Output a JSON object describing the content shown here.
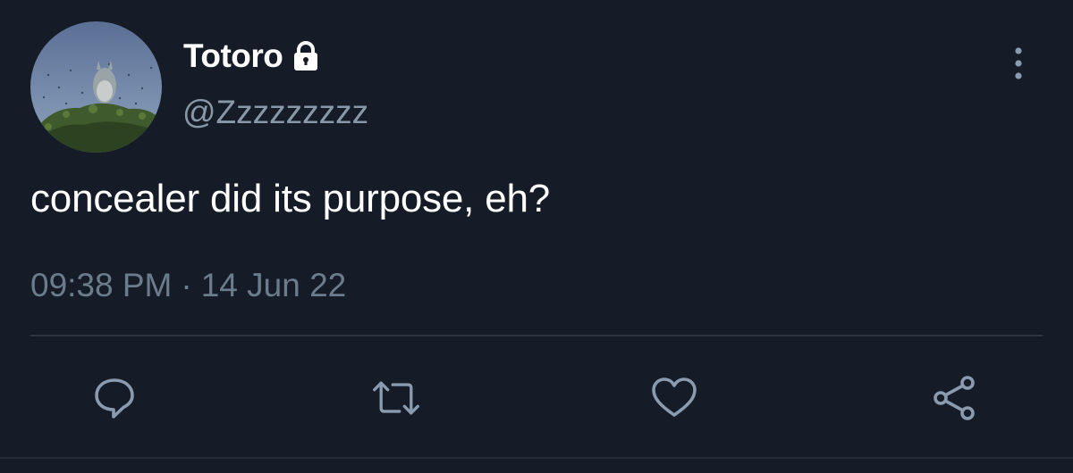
{
  "tweet": {
    "display_name": "Totoro",
    "handle": "@Zzzzzzzzz",
    "text": "concealer did its purpose, eh?",
    "time": "09:38 PM",
    "separator": "·",
    "date": "14 Jun 22",
    "protected": true
  },
  "icons": {
    "lock": "lock-icon",
    "more": "more-vertical-icon",
    "reply": "reply-icon",
    "retweet": "retweet-icon",
    "like": "heart-icon",
    "share": "share-icon"
  },
  "colors": {
    "background": "#151c27",
    "primary_text": "#ffffff",
    "secondary_text": "#8898a8",
    "icon": "#8a9bb0"
  }
}
